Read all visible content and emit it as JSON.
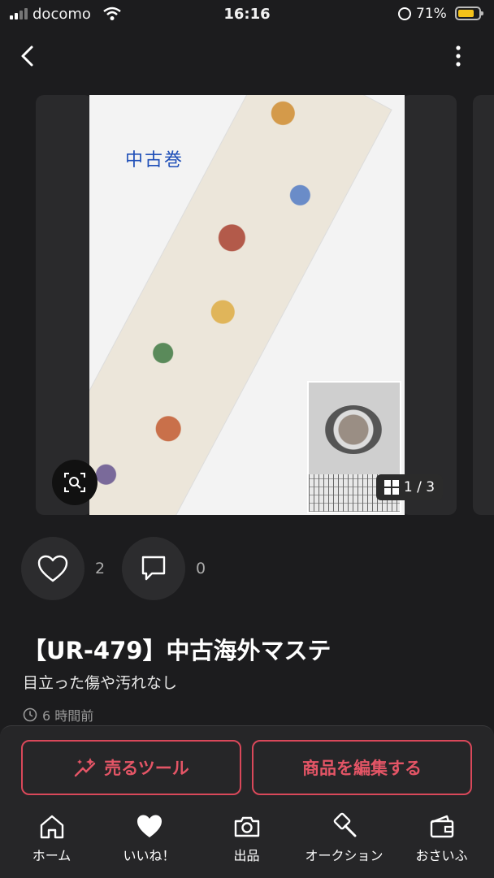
{
  "status_bar": {
    "carrier": "docomo",
    "time": "16:16",
    "battery": "71%"
  },
  "carousel": {
    "handwriting": "中古巻",
    "counter": "1 / 3"
  },
  "actions": {
    "likes": "2",
    "comments": "0"
  },
  "item": {
    "title": "【UR-479】中古海外マステ",
    "description": "目立った傷や汚れなし",
    "posted": "6 時間前"
  },
  "buttons": {
    "sell_tool": "売るツール",
    "edit": "商品を編集する"
  },
  "tabs": [
    {
      "label": "ホーム",
      "icon": "home-icon"
    },
    {
      "label": "いいね！",
      "icon": "heart-icon"
    },
    {
      "label": "出品",
      "icon": "camera-icon"
    },
    {
      "label": "オークション",
      "icon": "auction-icon"
    },
    {
      "label": "おさいふ",
      "icon": "wallet-icon"
    }
  ],
  "colors": {
    "accent": "#e45566",
    "background": "#1c1c1e",
    "battery": "#f4c21a"
  }
}
